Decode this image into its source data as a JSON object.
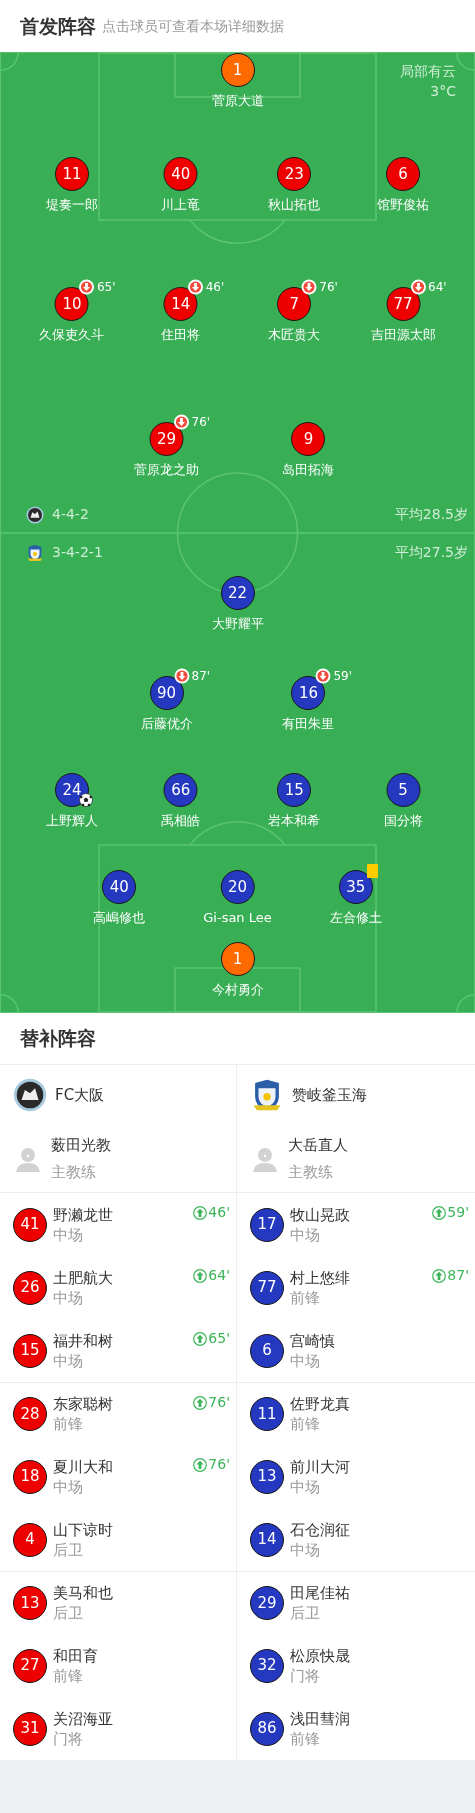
{
  "header": {
    "title": "首发阵容",
    "hint": "点击球员可查看本场详细数据"
  },
  "pitch": {
    "weather": {
      "condition": "局部有云",
      "temperature": "3°C"
    },
    "teams": [
      {
        "color": "#ee0000",
        "formation": "4-4-2",
        "average_age": "平均28.5岁",
        "lines": [
          [
            {
              "kind": "goalkeeper",
              "number": "1",
              "name": "菅原大道"
            }
          ],
          [
            {
              "kind": "outfield",
              "number": "11",
              "name": "堤奏一郎"
            },
            {
              "kind": "outfield",
              "number": "40",
              "name": "川上竜"
            },
            {
              "kind": "outfield",
              "number": "23",
              "name": "秋山拓也"
            },
            {
              "kind": "outfield",
              "number": "6",
              "name": "馆野俊祐"
            }
          ],
          [
            {
              "kind": "outfield",
              "number": "10",
              "name": "久保吏久斗",
              "events": [
                {
                  "kind": "sub_off",
                  "minute": "65'"
                }
              ]
            },
            {
              "kind": "outfield",
              "number": "14",
              "name": "住田将",
              "events": [
                {
                  "kind": "sub_off",
                  "minute": "46'"
                }
              ]
            },
            {
              "kind": "outfield",
              "number": "7",
              "name": "木匠贵大",
              "events": [
                {
                  "kind": "sub_off",
                  "minute": "76'"
                }
              ]
            },
            {
              "kind": "outfield",
              "number": "77",
              "name": "吉田源太郎",
              "events": [
                {
                  "kind": "sub_off",
                  "minute": "64'"
                }
              ]
            }
          ],
          [
            {
              "kind": "outfield",
              "number": "29",
              "name": "菅原龙之助",
              "events": [
                {
                  "kind": "sub_off",
                  "minute": "76'"
                }
              ]
            },
            {
              "kind": "outfield",
              "number": "9",
              "name": "岛田拓海"
            }
          ]
        ]
      },
      {
        "color": "#2438c0",
        "formation": "3-4-2-1",
        "average_age": "平均27.5岁",
        "lines": [
          [
            {
              "kind": "outfield",
              "number": "22",
              "name": "大野耀平"
            }
          ],
          [
            {
              "kind": "outfield",
              "number": "90",
              "name": "后藤优介",
              "events": [
                {
                  "kind": "sub_off",
                  "minute": "87'"
                }
              ]
            },
            {
              "kind": "outfield",
              "number": "16",
              "name": "有田朱里",
              "events": [
                {
                  "kind": "sub_off",
                  "minute": "59'"
                }
              ]
            }
          ],
          [
            {
              "kind": "outfield",
              "number": "24",
              "name": "上野辉人",
              "events": [
                {
                  "kind": "goal"
                }
              ]
            },
            {
              "kind": "outfield",
              "number": "66",
              "name": "禹相皓"
            },
            {
              "kind": "outfield",
              "number": "15",
              "name": "岩本和希"
            },
            {
              "kind": "outfield",
              "number": "5",
              "name": "国分将"
            }
          ],
          [
            {
              "kind": "outfield",
              "number": "40",
              "name": "高嶋修也"
            },
            {
              "kind": "outfield",
              "number": "20",
              "name": "Gi-san Lee"
            },
            {
              "kind": "outfield",
              "number": "35",
              "name": "左合修土",
              "events": [
                {
                  "kind": "yellow_card"
                }
              ]
            }
          ],
          [
            {
              "kind": "goalkeeper",
              "number": "1",
              "name": "今村勇介"
            }
          ]
        ]
      }
    ]
  },
  "substitutes": {
    "title": "替补阵容",
    "teams": [
      {
        "name": "FC大阪",
        "coach": {
          "name": "薮田光教",
          "role": "主教练"
        },
        "players": [
          {
            "number": "41",
            "name": "野濑龙世",
            "position": "中场",
            "sub_on": "46'"
          },
          {
            "number": "26",
            "name": "土肥航大",
            "position": "中场",
            "sub_on": "64'"
          },
          {
            "number": "15",
            "name": "福井和树",
            "position": "中场",
            "sub_on": "65'"
          },
          {
            "number": "28",
            "name": "东家聪树",
            "position": "前锋",
            "sub_on": "76'"
          },
          {
            "number": "18",
            "name": "夏川大和",
            "position": "中场",
            "sub_on": "76'"
          },
          {
            "number": "4",
            "name": "山下谅时",
            "position": "后卫"
          },
          {
            "number": "13",
            "name": "美马和也",
            "position": "后卫"
          },
          {
            "number": "27",
            "name": "和田育",
            "position": "前锋"
          },
          {
            "number": "31",
            "name": "关沼海亚",
            "position": "门将"
          }
        ]
      },
      {
        "name": "赞岐釜玉海",
        "coach": {
          "name": "大岳直人",
          "role": "主教练"
        },
        "players": [
          {
            "number": "17",
            "name": "牧山晃政",
            "position": "中场",
            "sub_on": "59'"
          },
          {
            "number": "77",
            "name": "村上悠绯",
            "position": "前锋",
            "sub_on": "87'"
          },
          {
            "number": "6",
            "name": "宫崎慎",
            "position": "中场"
          },
          {
            "number": "11",
            "name": "佐野龙真",
            "position": "前锋"
          },
          {
            "number": "13",
            "name": "前川大河",
            "position": "中场"
          },
          {
            "number": "14",
            "name": "石仓润征",
            "position": "中场"
          },
          {
            "number": "29",
            "name": "田尾佳祐",
            "position": "后卫"
          },
          {
            "number": "32",
            "name": "松原快晟",
            "position": "门将"
          },
          {
            "number": "86",
            "name": "浅田彗润",
            "position": "前锋"
          }
        ]
      }
    ]
  }
}
